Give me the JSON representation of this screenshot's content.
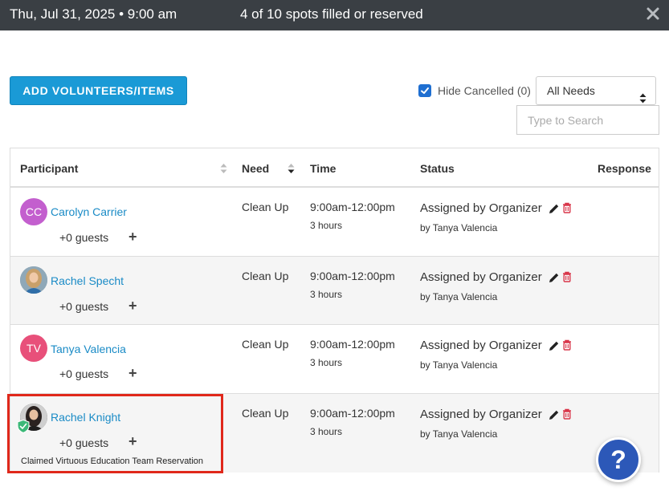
{
  "header": {
    "date": "Thu, Jul 31, 2025 • 9:00 am",
    "spots": "4 of 10 spots filled or reserved",
    "close_icon": "close-icon"
  },
  "toolbar": {
    "add_label": "ADD VOLUNTEERS/ITEMS",
    "hide_cancelled_label": "Hide Cancelled (0)",
    "hide_cancelled_checked": true,
    "needs_select_value": "All Needs",
    "search_placeholder": "Type to Search"
  },
  "table": {
    "columns": [
      "Participant",
      "Need",
      "Time",
      "Status",
      "Response"
    ],
    "rows": [
      {
        "initials": "CC",
        "avatar_color": "#c35fce",
        "name": "Carolyn Carrier",
        "guests": "+0 guests",
        "need": "Clean Up",
        "time": "9:00am-12:00pm",
        "duration": "3 hours",
        "status": "Assigned by Organizer",
        "by": "by Tanya Valencia"
      },
      {
        "initials": "",
        "avatar_color": "#6b8aa0",
        "name": "Rachel Specht",
        "guests": "+0 guests",
        "need": "Clean Up",
        "time": "9:00am-12:00pm",
        "duration": "3 hours",
        "status": "Assigned by Organizer",
        "by": "by Tanya Valencia"
      },
      {
        "initials": "TV",
        "avatar_color": "#e8507a",
        "name": "Tanya Valencia",
        "guests": "+0 guests",
        "need": "Clean Up",
        "time": "9:00am-12:00pm",
        "duration": "3 hours",
        "status": "Assigned by Organizer",
        "by": "by Tanya Valencia"
      },
      {
        "initials": "",
        "avatar_color": "#3a3a3a",
        "name": "Rachel Knight",
        "guests": "+0 guests",
        "need": "Clean Up",
        "time": "9:00am-12:00pm",
        "duration": "3 hours",
        "status": "Assigned by Organizer",
        "by": "by Tanya Valencia",
        "note": "Claimed Virtuous Education Team Reservation"
      }
    ]
  },
  "help": {
    "label": "?"
  },
  "colors": {
    "header_bg": "#3a3f44",
    "accent": "#1a9ad6",
    "link": "#1a8bc6",
    "trash": "#d9364a",
    "highlight": "#e0281b",
    "help": "#2c58b8"
  }
}
